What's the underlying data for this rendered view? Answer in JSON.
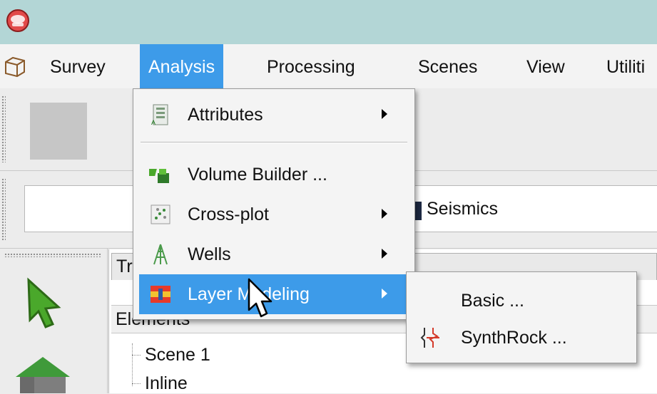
{
  "menubar": {
    "items": [
      {
        "label": "Survey"
      },
      {
        "label": "Analysis"
      },
      {
        "label": "Processing"
      },
      {
        "label": "Scenes"
      },
      {
        "label": "View"
      },
      {
        "label": "Utiliti"
      }
    ],
    "active_item": "Analysis"
  },
  "analysis_menu": {
    "items": [
      {
        "label": "Attributes",
        "icon": "attributes-icon",
        "has_submenu": true
      },
      {
        "label": "Volume Builder ...",
        "icon": "volume-builder-icon",
        "has_submenu": false
      },
      {
        "label": "Cross-plot",
        "icon": "cross-plot-icon",
        "has_submenu": true
      },
      {
        "label": "Wells",
        "icon": "wells-icon",
        "has_submenu": true
      },
      {
        "label": "Layer Modeling",
        "icon": "layer-modeling-icon",
        "has_submenu": true
      }
    ],
    "highlighted_item": "Layer Modeling"
  },
  "layer_modeling_submenu": {
    "items": [
      {
        "label": "Basic ..."
      },
      {
        "label": "SynthRock ...",
        "icon": "synthrock-icon"
      }
    ]
  },
  "toolbar": {
    "seismics_label": "Seismics"
  },
  "tree": {
    "tab_title": "Tr",
    "header": "Elements",
    "items": [
      {
        "label": "Scene 1"
      },
      {
        "label": "Inline"
      }
    ]
  },
  "colors": {
    "titlebar": "#b3d6d6",
    "menu_highlight": "#3d9be9",
    "menu_background": "#f4f4f4"
  }
}
